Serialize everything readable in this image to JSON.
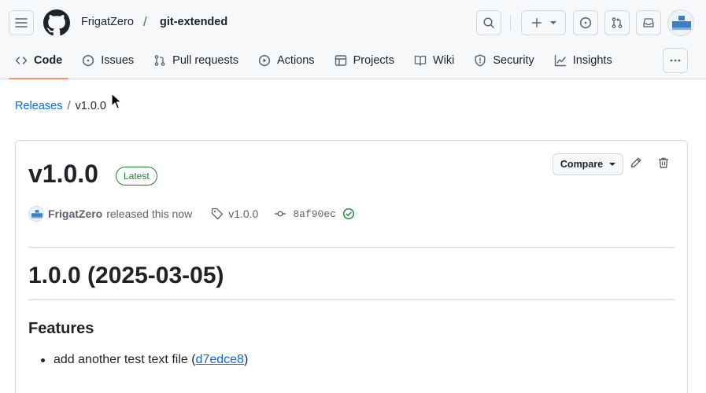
{
  "header": {
    "owner": "FrigatZero",
    "separator": "/",
    "repo": "git-extended"
  },
  "tabs": [
    {
      "label": "Code",
      "icon": "code-icon"
    },
    {
      "label": "Issues",
      "icon": "issue-opened-icon"
    },
    {
      "label": "Pull requests",
      "icon": "git-pull-request-icon"
    },
    {
      "label": "Actions",
      "icon": "play-icon"
    },
    {
      "label": "Projects",
      "icon": "table-icon"
    },
    {
      "label": "Wiki",
      "icon": "book-icon"
    },
    {
      "label": "Security",
      "icon": "shield-icon"
    },
    {
      "label": "Insights",
      "icon": "graph-icon"
    }
  ],
  "breadcrumb": {
    "releases": "Releases",
    "separator": "/",
    "current": "v1.0.0"
  },
  "release": {
    "title": "v1.0.0",
    "badge": "Latest",
    "compare_label": "Compare",
    "author": "FrigatZero",
    "action_text": "released this now",
    "tag": "v1.0.0",
    "commit": "8af90ec",
    "body": {
      "heading": "1.0.0 (2025-03-05)",
      "section": "Features",
      "items": [
        {
          "text": "add another test text file (",
          "link": "d7edce8",
          "suffix": ")"
        }
      ]
    }
  },
  "colors": {
    "accent_link": "#0969da",
    "latest_green": "#1a7f37",
    "tab_underline": "#fd8c73"
  }
}
